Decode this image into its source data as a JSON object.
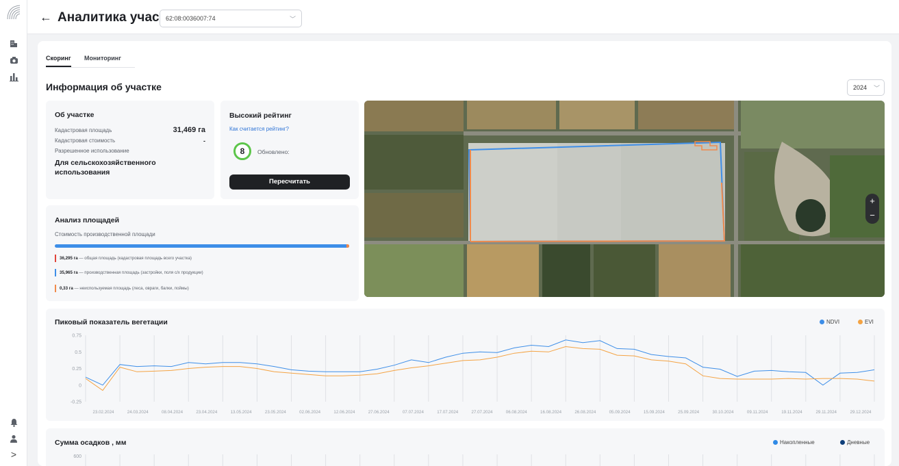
{
  "colors": {
    "accent_blue": "#3d8ee8",
    "accent_orange": "#f4a343",
    "unused_orange": "#f08a4b",
    "total_red": "#e0443a",
    "rating_green": "#5cc54a",
    "precip_accum": "#2f8ae6",
    "precip_daily": "#0f3f7a"
  },
  "sidebar": {
    "icons": [
      "building-icon",
      "camera-icon",
      "bar-chart-icon"
    ],
    "bottom_icons": [
      "bell-icon",
      "user-icon"
    ],
    "expand": ">"
  },
  "header": {
    "back": "←",
    "title": "Аналитика участка",
    "cadastral_number": "62:08:0036007:74"
  },
  "tabs": [
    {
      "label": "Скоринг",
      "active": true
    },
    {
      "label": "Мониторинг",
      "active": false
    }
  ],
  "section_title": "Информация об участке",
  "year": "2024",
  "about": {
    "title": "Об участке",
    "area_label": "Кадастровая площадь",
    "area_value": "31,469 га",
    "cost_label": "Кадастровая стоимость",
    "cost_value": "-",
    "usage_label": "Разрешенное использование",
    "usage_value": "Для сельскохозяйственного использования"
  },
  "rating": {
    "title": "Высокий рейтинг",
    "link": "Как считается рейтинг?",
    "score": "8",
    "updated_label": "Обновлено:",
    "button": "Пересчитать"
  },
  "area": {
    "title": "Анализ площадей",
    "subtitle": "Стоимость производственной площади",
    "unused_fraction": 0.009,
    "rows": [
      {
        "value": "36,295 га",
        "text": " — общая площадь (кадастровая площадь всего участка)"
      },
      {
        "value": "35,965 га",
        "text": " — производственная площадь (застройки, поля с/х продукции)"
      },
      {
        "value": "0,33 га",
        "text": " — неиспользуемая площадь (леса, овраги, балки, поймы)"
      }
    ]
  },
  "map": {
    "zoom_in": "+",
    "zoom_out": "−"
  },
  "vegetation": {
    "title": "Пиковый показатель вегетации",
    "legend": [
      "NDVI",
      "EVI"
    ]
  },
  "precipitation": {
    "title": "Сумма осадков , мм",
    "legend": [
      "Накопленные",
      "Дневные"
    ],
    "y_top_label": "600"
  },
  "chart_data": [
    {
      "type": "line",
      "title": "Пиковый показатель вегетации",
      "x": [
        "23.02.2024",
        "24.03.2024",
        "08.04.2024",
        "23.04.2024",
        "13.05.2024",
        "23.05.2024",
        "02.06.2024",
        "12.06.2024",
        "27.06.2024",
        "07.07.2024",
        "17.07.2024",
        "27.07.2024",
        "06.08.2024",
        "16.08.2024",
        "26.08.2024",
        "05.09.2024",
        "15.09.2024",
        "25.09.2024",
        "30.10.2024",
        "09.11.2024",
        "19.11.2024",
        "29.11.2024",
        "29.12.2024"
      ],
      "yticks": [
        "0.75",
        "0.5",
        "0.25",
        "0",
        "-0.25"
      ],
      "ylim": [
        -0.25,
        0.75
      ],
      "legend_position": "top-right",
      "series": [
        {
          "name": "NDVI",
          "color": "#3d8ee8",
          "values": [
            0.12,
            0.0,
            0.31,
            0.28,
            0.29,
            0.28,
            0.34,
            0.32,
            0.34,
            0.34,
            0.32,
            0.28,
            0.23,
            0.21,
            0.2,
            0.2,
            0.2,
            0.24,
            0.3,
            0.38,
            0.34,
            0.42,
            0.48,
            0.5,
            0.49,
            0.56,
            0.6,
            0.58,
            0.68,
            0.64,
            0.67,
            0.55,
            0.54,
            0.46,
            0.43,
            0.41,
            0.27,
            0.24,
            0.13,
            0.21,
            0.22,
            0.2,
            0.19,
            0.0,
            0.18,
            0.19,
            0.23
          ]
        },
        {
          "name": "EVI",
          "color": "#f4a343",
          "values": [
            0.1,
            -0.08,
            0.27,
            0.2,
            0.21,
            0.22,
            0.25,
            0.27,
            0.28,
            0.28,
            0.25,
            0.2,
            0.18,
            0.16,
            0.14,
            0.14,
            0.15,
            0.17,
            0.22,
            0.26,
            0.29,
            0.33,
            0.37,
            0.38,
            0.42,
            0.48,
            0.51,
            0.5,
            0.58,
            0.55,
            0.54,
            0.45,
            0.44,
            0.38,
            0.36,
            0.32,
            0.14,
            0.1,
            0.09,
            0.09,
            0.09,
            0.1,
            0.09,
            0.1,
            0.1,
            0.09,
            0.06
          ]
        }
      ]
    },
    {
      "type": "line",
      "title": "Сумма осадков , мм",
      "yticks": [
        "600"
      ],
      "legend_position": "top-right",
      "series": [
        {
          "name": "Накопленные",
          "color": "#2f8ae6"
        },
        {
          "name": "Дневные",
          "color": "#0f3f7a"
        }
      ]
    }
  ]
}
